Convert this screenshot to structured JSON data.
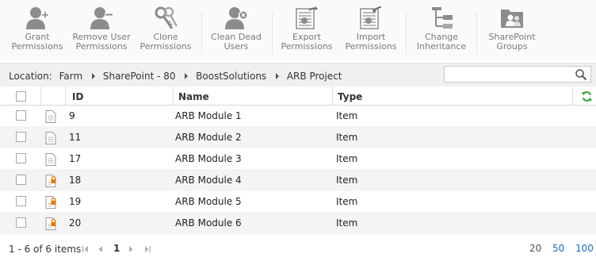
{
  "ribbon": {
    "buttons": [
      {
        "label": "Grant Permissions",
        "icon": "user-add-icon"
      },
      {
        "label": "Remove User Permissions",
        "icon": "user-remove-icon"
      },
      {
        "label": "Clone Permissions",
        "icon": "clone-keys-icon"
      },
      {
        "label": "Clean Dead Users",
        "icon": "user-clean-icon"
      },
      {
        "label": "Export Permissions",
        "icon": "export-icon"
      },
      {
        "label": "Import Permissions",
        "icon": "import-icon"
      },
      {
        "label": "Change Inheritance",
        "icon": "inheritance-icon"
      },
      {
        "label": "SharePoint Groups",
        "icon": "groups-icon"
      }
    ]
  },
  "breadcrumb": {
    "prefix": "Location:",
    "items": [
      "Farm",
      "SharePoint - 80",
      "BoostSolutions",
      "ARB Project"
    ]
  },
  "search": {
    "placeholder": "",
    "value": ""
  },
  "grid": {
    "columns": {
      "id": "ID",
      "name": "Name",
      "type": "Type"
    },
    "rows": [
      {
        "id": "9",
        "name": "ARB Module 1",
        "type": "Item",
        "icon": "document-icon"
      },
      {
        "id": "11",
        "name": "ARB Module 2",
        "type": "Item",
        "icon": "document-icon"
      },
      {
        "id": "17",
        "name": "ARB Module 3",
        "type": "Item",
        "icon": "document-icon"
      },
      {
        "id": "18",
        "name": "ARB Module 4",
        "type": "Item",
        "icon": "document-locked-icon"
      },
      {
        "id": "19",
        "name": "ARB Module 5",
        "type": "Item",
        "icon": "document-locked-icon"
      },
      {
        "id": "20",
        "name": "ARB Module 6",
        "type": "Item",
        "icon": "document-locked-icon"
      }
    ]
  },
  "pager": {
    "info": "1 - 6 of 6 items",
    "current_page": "1",
    "page_sizes": [
      "20",
      "50",
      "100"
    ],
    "selected_page_size": "20"
  },
  "colors": {
    "ribbon_icon": "#8c8c8c",
    "link_blue": "#1e6bb8",
    "refresh_green": "#3aa53a",
    "lock_orange": "#e07b00"
  }
}
